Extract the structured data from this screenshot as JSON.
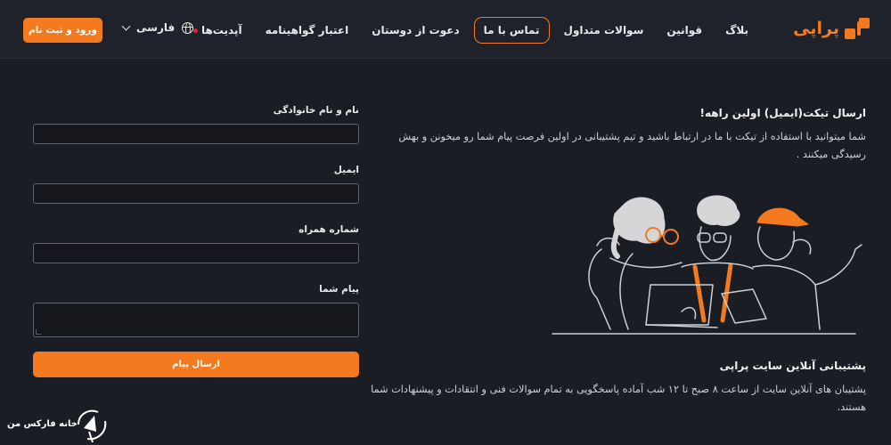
{
  "header": {
    "logo_text": "پراپی",
    "nav": [
      {
        "label": "بلاگ",
        "name": "nav-blog"
      },
      {
        "label": "قوانین",
        "name": "nav-rules"
      },
      {
        "label": "سوالات متداول",
        "name": "nav-faq"
      },
      {
        "label": "تماس با ما",
        "name": "nav-contact",
        "active": true
      },
      {
        "label": "دعوت از دوستان",
        "name": "nav-invite"
      },
      {
        "label": "اعتبار گواهینامه",
        "name": "nav-certificate"
      },
      {
        "label": "آپدیت‌ها",
        "name": "nav-updates",
        "dot": true
      }
    ],
    "language": "فارسی",
    "login_label": "ورود و ثبت نام"
  },
  "ticket": {
    "title": "ارسال تیکت(ایمیل) اولین راهه!",
    "body": "شما میتوانید با استفاده از تیکت با ما در ارتباط باشید و تیم پشتیبانی در اولین فرصت پیام شما رو میخونن و بهش رسیدگی میکنند ."
  },
  "support": {
    "title": "پشتیبانی آنلاین سایت پراپی",
    "body": "پشتیبان های آنلاین سایت از ساعت ۸ صبح تا ۱۲ شب آماده پاسخگویی به تمام سوالات فنی و انتقادات و پیشنهادات شما هستند."
  },
  "form": {
    "name_label": "نام و نام خانوادگی",
    "email_label": "ایمیل",
    "phone_label": "شماره همراه",
    "message_label": "پیام شما",
    "submit_label": "ارسال پیام"
  },
  "watermark": "خانه فارکس من",
  "colors": {
    "accent": "#f37a1f",
    "background": "#1b1d24",
    "header": "#1f222b"
  }
}
